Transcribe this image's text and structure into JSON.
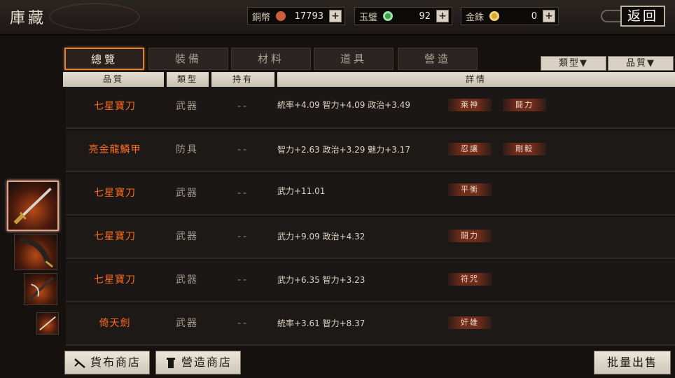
{
  "header": {
    "title": "庫藏",
    "back_label": "返回",
    "currencies": [
      {
        "label": "銅幣",
        "value": "17793",
        "icon": "copper-coin-icon",
        "color": "#c8603a"
      },
      {
        "label": "玉璧",
        "value": "92",
        "icon": "jade-disc-icon",
        "color": "#3ea04a"
      },
      {
        "label": "金銖",
        "value": "0",
        "icon": "gold-coin-icon",
        "color": "#d8a830"
      }
    ]
  },
  "tabs": [
    "總覽",
    "裝備",
    "材料",
    "道具",
    "營造"
  ],
  "active_tab": "總覽",
  "filters": [
    "類型▼",
    "品質▼"
  ],
  "columns": [
    "品質",
    "類型",
    "持有",
    "詳情"
  ],
  "items": [
    {
      "name": "七星寶刀",
      "type": "武器",
      "owned": "--",
      "stats": "統率+4.09 智力+4.09 政治+3.49",
      "tags": [
        "萊神",
        "鬪力"
      ]
    },
    {
      "name": "亮金龍鱗甲",
      "type": "防具",
      "owned": "--",
      "stats": "智力+2.63 政治+3.29 魅力+3.17",
      "tags": [
        "忍讓",
        "剛毅"
      ]
    },
    {
      "name": "七星寶刀",
      "type": "武器",
      "owned": "--",
      "stats": "武力+11.01",
      "tags": [
        "平衡"
      ]
    },
    {
      "name": "七星寶刀",
      "type": "武器",
      "owned": "--",
      "stats": "武力+9.09 政治+4.32",
      "tags": [
        "鬪力"
      ]
    },
    {
      "name": "七星寶刀",
      "type": "武器",
      "owned": "--",
      "stats": "武力+6.35 智力+3.23",
      "tags": [
        "符咒"
      ]
    },
    {
      "name": "倚天劍",
      "type": "武器",
      "owned": "--",
      "stats": "統率+3.61 智力+8.37",
      "tags": [
        "奸雄"
      ]
    }
  ],
  "thumbnails": [
    "sword-icon",
    "blade-icon",
    "spear-icon",
    "sword-icon"
  ],
  "bottom": {
    "shop1": "貨布商店",
    "shop2": "營造商店",
    "bulk_sell": "批量出售"
  }
}
